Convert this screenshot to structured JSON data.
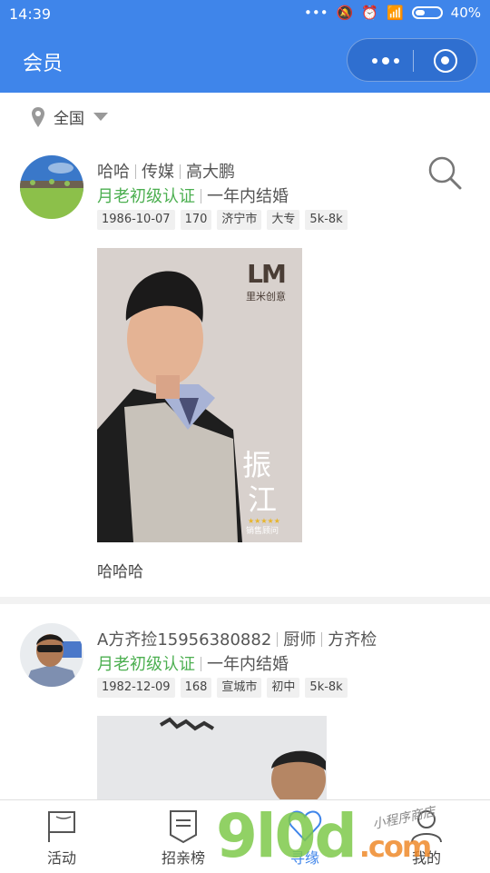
{
  "status_bar": {
    "time": "14:39",
    "battery": "40%"
  },
  "header": {
    "title": "会员"
  },
  "location": {
    "label": "全国"
  },
  "members": [
    {
      "name": "哈哈",
      "occupation": "传媒",
      "real_name": "高大鹏",
      "certification": "月老初级认证",
      "marriage_plan": "一年内结婚",
      "tags": [
        "1986-10-07",
        "170",
        "济宁市",
        "大专",
        "5k-8k"
      ],
      "photo_text": {
        "brand": "里米创意",
        "name_line1": "振",
        "name_line2": "江",
        "role": "销售顾问"
      },
      "caption": "哈哈哈"
    },
    {
      "name": "A方齐捡15956380882",
      "occupation": "厨师",
      "real_name": "方齐检",
      "certification": "月老初级认证",
      "marriage_plan": "一年内结婚",
      "tags": [
        "1982-12-09",
        "168",
        "宣城市",
        "初中",
        "5k-8k"
      ]
    }
  ],
  "tabbar": [
    {
      "label": "活动",
      "icon": "flag-icon"
    },
    {
      "label": "招亲榜",
      "icon": "banner-icon"
    },
    {
      "label": "寻缘",
      "icon": "heart-icon"
    },
    {
      "label": "我的",
      "icon": "user-icon"
    }
  ],
  "watermark": {
    "main": "9l0d",
    "suffix": ".com",
    "small": "小程序商店"
  },
  "colors": {
    "brand_blue": "#3f85ea",
    "cert_green": "#4caf50"
  }
}
